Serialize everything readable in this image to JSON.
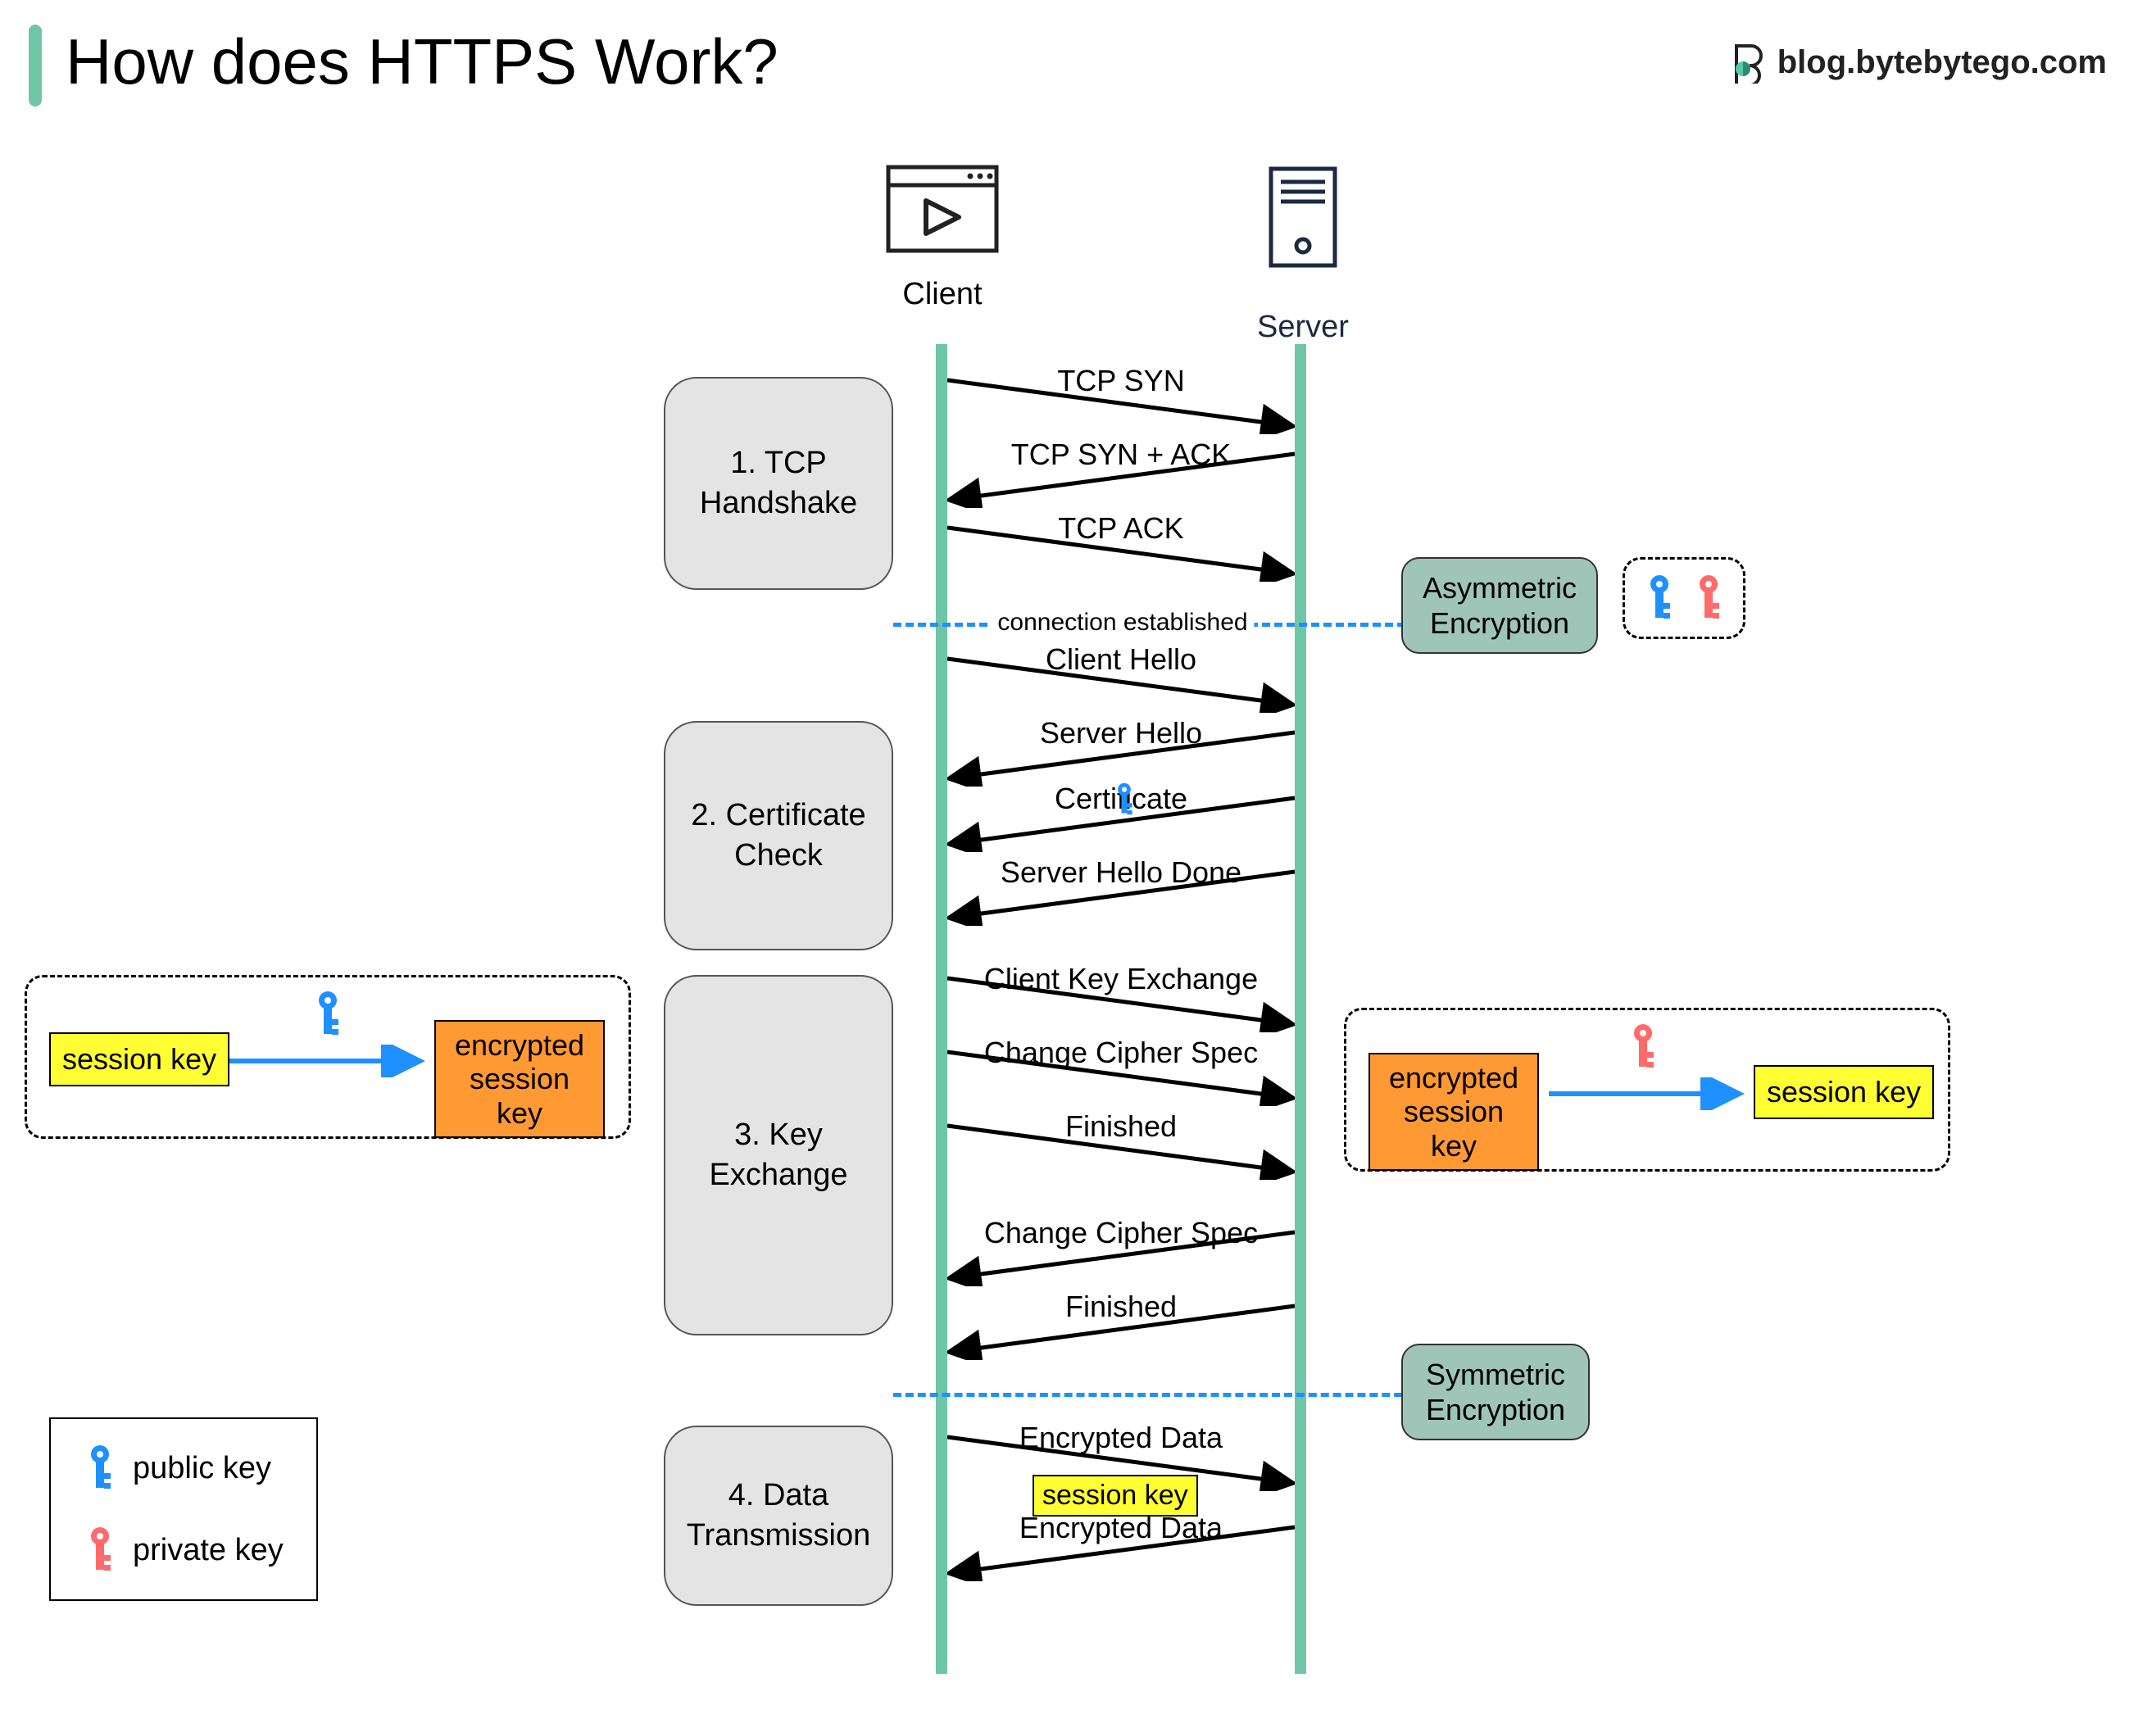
{
  "title": "How does HTTPS Work?",
  "brand": "blog.bytebytego.com",
  "actors": {
    "client": "Client",
    "server": "Server"
  },
  "phases": {
    "p1": "1. TCP Handshake",
    "p2": "2. Certificate Check",
    "p3": "3. Key Exchange",
    "p4": "4. Data Transmission"
  },
  "messages": {
    "m1": "TCP SYN",
    "m2": "TCP SYN + ACK",
    "m3": "TCP ACK",
    "m4": "Client Hello",
    "m5": "Server Hello",
    "m6": "Certificate",
    "m7": "Server Hello Done",
    "m8": "Client Key Exchange",
    "m9": "Change Cipher Spec",
    "m10": "Finished",
    "m11": "Change Cipher Spec",
    "m12": "Finished",
    "m13": "Encrypted  Data",
    "m14": "Encrypted Data"
  },
  "dividers": {
    "d1": "connection established"
  },
  "enc": {
    "asym": "Asymmetric Encryption",
    "sym": "Symmetric Encryption"
  },
  "boxes": {
    "sessionKey": "session key",
    "encSessionKey": "encrypted session key"
  },
  "legend": {
    "public": "public key",
    "private": "private key"
  }
}
